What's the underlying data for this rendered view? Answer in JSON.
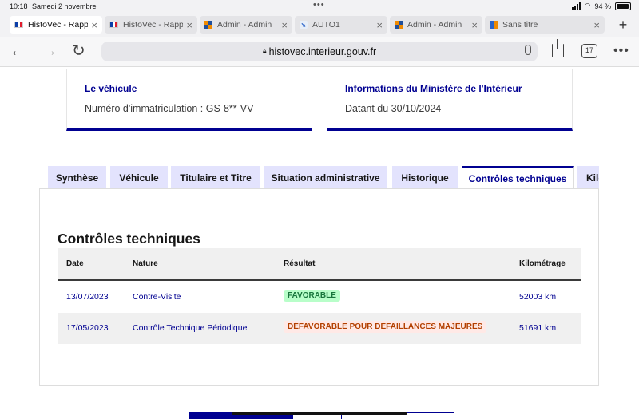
{
  "status_bar": {
    "time": "10:18",
    "date": "Samedi 2 novembre",
    "battery": "94 %",
    "battery_level": 0.94
  },
  "browser_tabs": [
    {
      "title": "HistoVec - Rapport",
      "icon": "french-flag-icon",
      "active": true
    },
    {
      "title": "HistoVec - Rapport",
      "icon": "french-flag-icon",
      "active": false
    },
    {
      "title": "Admin - Admin",
      "icon": "admin-icon",
      "active": false
    },
    {
      "title": "AUTO1",
      "icon": "auto1-icon",
      "active": false
    },
    {
      "title": "Admin - Admin",
      "icon": "admin-icon",
      "active": false
    },
    {
      "title": "Sans titre",
      "icon": "sans-titre-icon",
      "active": false
    }
  ],
  "nav": {
    "url": "histovec.interieur.gouv.fr",
    "tab_count": "17"
  },
  "cards": {
    "vehicle": {
      "title": "Le véhicule",
      "text": "Numéro d'immatriculation : GS-8**-VV"
    },
    "ministry": {
      "title": "Informations du Ministère de l'Intérieur",
      "text": "Datant du 30/10/2024"
    }
  },
  "tabs": [
    {
      "label": "Synthèse"
    },
    {
      "label": "Véhicule"
    },
    {
      "label": "Titulaire et Titre"
    },
    {
      "label": "Situation administrative"
    },
    {
      "label": "Historique"
    },
    {
      "label": "Contrôles techniques",
      "active": true
    },
    {
      "label": "Kilométrage"
    }
  ],
  "section": {
    "title": "Contrôles techniques"
  },
  "table": {
    "headers": [
      "Date",
      "Nature",
      "Résultat",
      "Kilométrage"
    ],
    "rows": [
      {
        "date": "13/07/2023",
        "nature": "Contre-Visite",
        "result": "FAVORABLE",
        "result_status": "favorable",
        "km": "52003 km"
      },
      {
        "date": "17/05/2023",
        "nature": "Contrôle Technique Périodique",
        "result": "DÉFAVORABLE POUR DÉFAILLANCES MAJEURES",
        "result_status": "defavorable",
        "km": "51691 km"
      }
    ]
  },
  "colors": {
    "accent": "#000091",
    "tab_bg": "#e3e3fd",
    "favorable_bg": "#b8fec9",
    "favorable_text": "#18753c",
    "defavorable_bg": "#ffe9e6",
    "defavorable_text": "#b34000"
  }
}
